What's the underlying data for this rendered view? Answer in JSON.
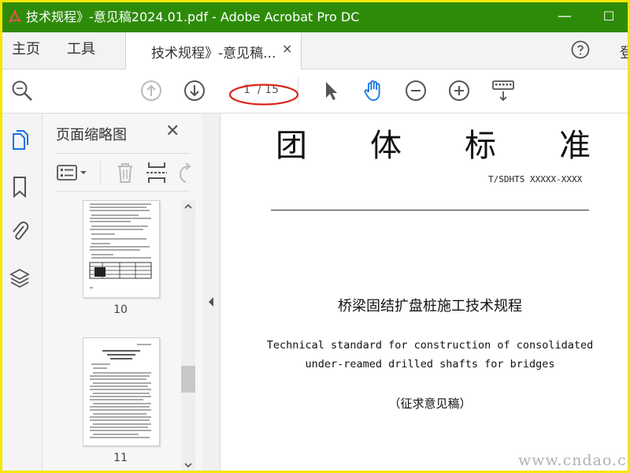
{
  "window": {
    "title": "技术规程》-意见稿2024.01.pdf - Adobe Acrobat Pro DC",
    "minimize_glyph": "—",
    "maximize_glyph": "☐"
  },
  "menu": {
    "home": "主页",
    "tools": "工具",
    "login": "登"
  },
  "tab": {
    "label": "技术规程》-意见稿...",
    "close": "×"
  },
  "toolbar": {
    "current_page": "1",
    "total_pages": "/ 15"
  },
  "thumbnails": {
    "title": "页面缩略图",
    "close": "✕",
    "pages": [
      {
        "number": "10"
      },
      {
        "number": "11"
      }
    ]
  },
  "document": {
    "heading_chars": [
      "团",
      "体",
      "标",
      "准"
    ],
    "standard_code": "T/SDHTS  XXXXX-XXXX",
    "title_cn": "桥梁固结扩盘桩施工技术规程",
    "title_en_line1": "Technical standard for construction of consolidated",
    "title_en_line2": "under-reamed drilled shafts for bridges",
    "draft_label": "（征求意见稿）"
  },
  "watermark": "www.cndao.com",
  "colors": {
    "titlebar": "#2e8b0a",
    "frame": "#f2e600",
    "annotation": "#d9261c",
    "hand_tool": "#1473e6"
  }
}
